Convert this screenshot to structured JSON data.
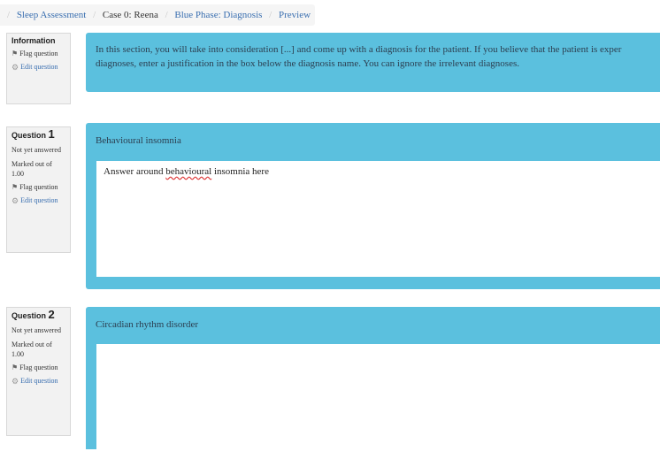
{
  "breadcrumb": {
    "items": [
      "Sleep Assessment",
      "Case 0: Reena",
      "Blue Phase: Diagnosis",
      "Preview"
    ]
  },
  "info_block": {
    "heading": "Information",
    "flag_label": "Flag question",
    "edit_label": "Edit question",
    "text": "In this section, you will take into consideration [...] and come up with a diagnosis for the patient. If you believe that the patient is exper",
    "text_line2": "diagnoses, enter a justification in the box below the diagnosis name. You can ignore the irrelevant diagnoses."
  },
  "questions": [
    {
      "label": "Question",
      "number": "1",
      "status": "Not yet answered",
      "marks": "Marked out of 1.00",
      "flag_label": "Flag question",
      "edit_label": "Edit question",
      "title": "Behavioural insomnia",
      "answer_prefix": "Answer around ",
      "answer_misspelled": "behavioural",
      "answer_suffix": " insomnia here"
    },
    {
      "label": "Question",
      "number": "2",
      "status": "Not yet answered",
      "marks": "Marked out of 1.00",
      "flag_label": "Flag question",
      "edit_label": "Edit question",
      "title": "Circadian rhythm disorder",
      "answer_prefix": "",
      "answer_misspelled": "",
      "answer_suffix": ""
    }
  ],
  "colors": {
    "content_bg": "#5bc0de",
    "link": "#3a6fb0",
    "sidebar_bg": "#f2f2f2"
  },
  "icons": {
    "flag": "flag-icon",
    "edit": "gear-icon"
  }
}
